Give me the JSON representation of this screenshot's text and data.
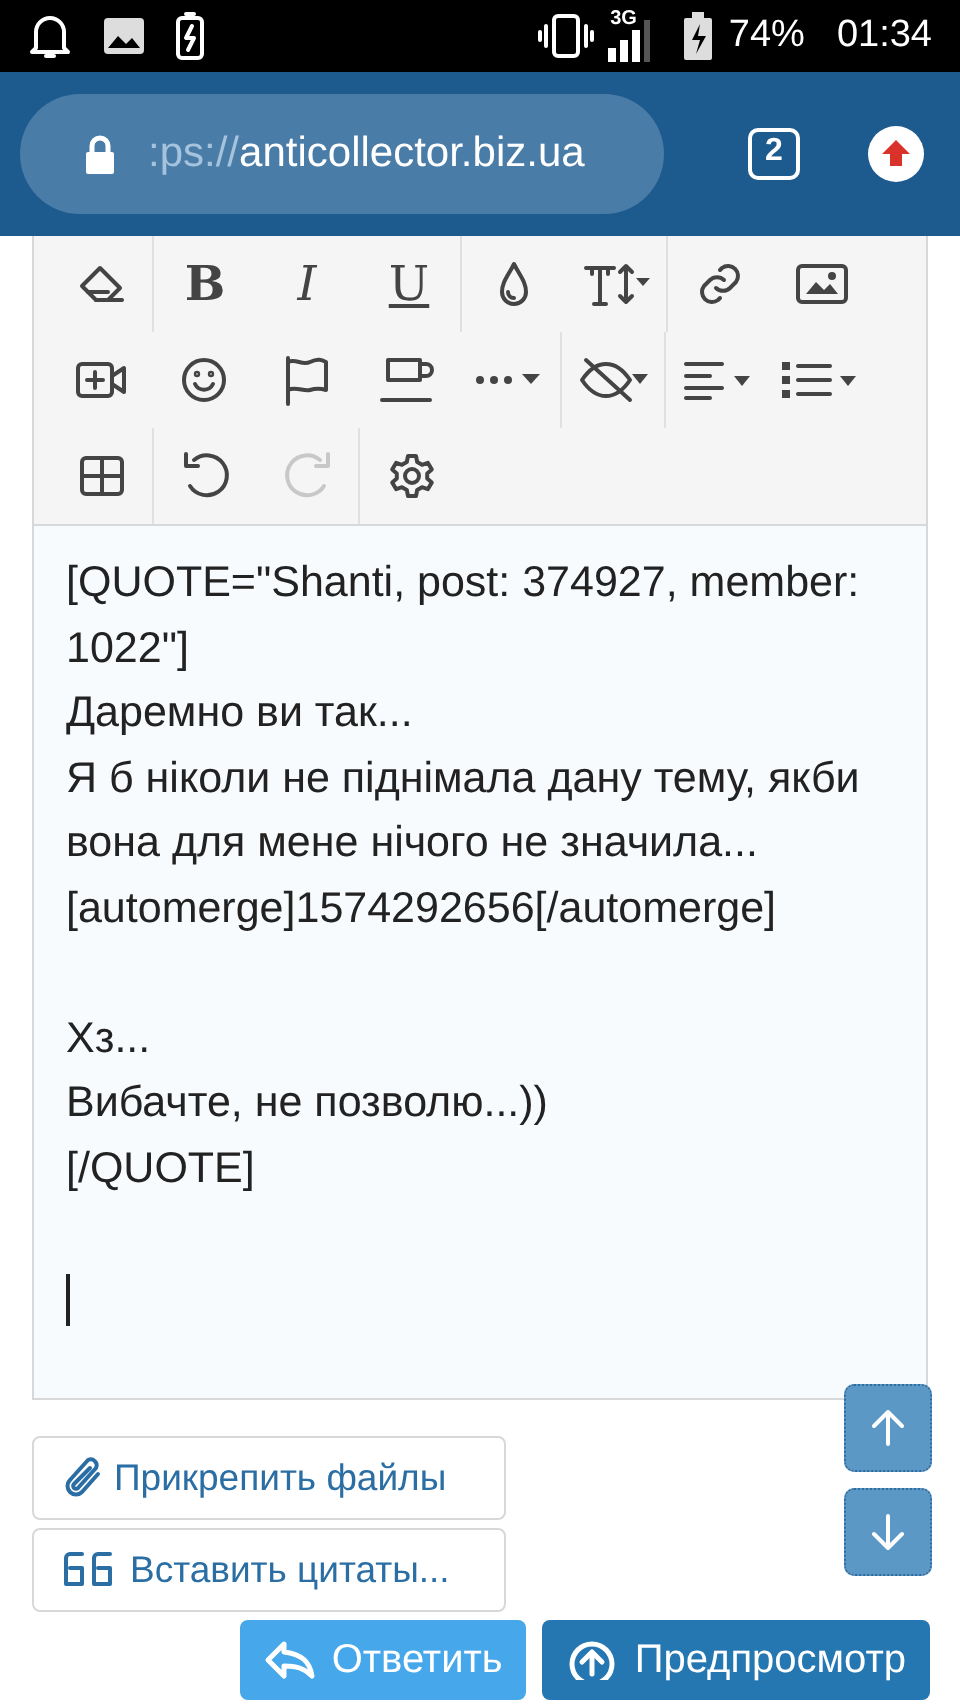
{
  "status_bar": {
    "network": "3G",
    "battery": "74%",
    "time": "01:34"
  },
  "browser": {
    "url_prefix": ":ps://",
    "url_host": "anticollector.biz.ua",
    "tab_count": "2"
  },
  "toolbar": [
    [
      [
        {
          "kind": "eraser",
          "disabled": false
        }
      ],
      [
        {
          "kind": "bold",
          "label": "B",
          "disabled": false
        },
        {
          "kind": "italic",
          "label": "I",
          "disabled": false
        },
        {
          "kind": "underline",
          "label": "U",
          "disabled": false
        }
      ],
      [
        {
          "kind": "color",
          "disabled": false
        },
        {
          "kind": "font-size",
          "dropdown": true,
          "disabled": false
        }
      ],
      [
        {
          "kind": "link",
          "disabled": false
        },
        {
          "kind": "image",
          "disabled": false
        }
      ]
    ],
    [
      [
        {
          "kind": "video",
          "disabled": false
        },
        {
          "kind": "smiley",
          "disabled": false
        },
        {
          "kind": "flag",
          "disabled": false
        },
        {
          "kind": "cup",
          "disabled": false
        },
        {
          "kind": "more",
          "dropdown": true,
          "disabled": false
        }
      ],
      [
        {
          "kind": "hide",
          "dropdown": true,
          "disabled": false
        }
      ],
      [
        {
          "kind": "align",
          "dropdown": true,
          "disabled": false
        },
        {
          "kind": "list",
          "dropdown": true,
          "disabled": false
        }
      ]
    ],
    [
      [
        {
          "kind": "table",
          "disabled": false
        }
      ],
      [
        {
          "kind": "undo",
          "disabled": false
        },
        {
          "kind": "redo",
          "disabled": true
        }
      ],
      [
        {
          "kind": "settings",
          "disabled": false
        }
      ]
    ]
  ],
  "editor": {
    "text": "[QUOTE=\"Shanti, post: 374927, member: 1022\"]\nДаремно ви так...\nЯ б ніколи не піднімала дану тему, якби вона для мене нічого не значила...\n[automerge]1574292656[/automerge]\n\nХз...\nВибачте, не позволю...))\n[/QUOTE]\n\n"
  },
  "attach_button": "Прикрепить файлы",
  "insert_quotes_button": "Вставить цитаты...",
  "submit_buttons": [
    {
      "kind": "reply",
      "label": "Ответить"
    },
    {
      "kind": "preview",
      "label": "Предпросмотр"
    }
  ]
}
